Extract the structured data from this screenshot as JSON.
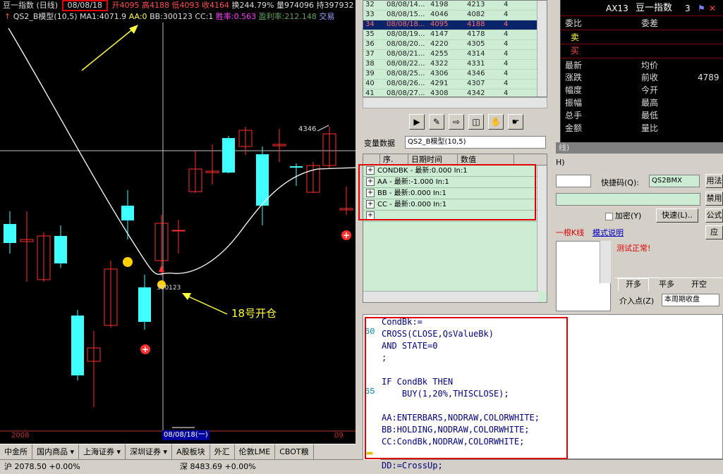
{
  "chart": {
    "header_title": "豆一指数 (日线)",
    "header_date": "08/08/18",
    "header_open": "开4095",
    "header_high": "高4188",
    "header_low": "低4093",
    "header_close": "收4164",
    "header_change": "换244.79%",
    "header_vol": "量974096",
    "header_hold": "持397932",
    "indicator_line": "QS2_B模型(10,5) MA1:4071.9",
    "ind_aa": "AA:0",
    "ind_bb": "BB:300123",
    "ind_cc": "CC:1",
    "ind_winrate": "胜率:0.563",
    "ind_profit": "盈利率:212.148",
    "ind_trade": "交易",
    "price_label_top": "4346",
    "price_label_bottom": "300123",
    "annotation": "18号开仓",
    "axis_year_left": "2008",
    "axis_date": "08/08/18(一)",
    "axis_right": "09",
    "colors": {
      "up": "#ff3030",
      "down": "#40ffff",
      "ma": "#ffffff",
      "annot": "#ffff40"
    }
  },
  "tabs": [
    "中金所",
    "国内商品 ▾",
    "上海证券 ▾",
    "深圳证券 ▾",
    "A股板块",
    "外汇",
    "伦敦LME",
    "CBOT粮"
  ],
  "status": {
    "sh": "沪 2078.50 +0.00%",
    "sz": "深 8483.69 +0.00%"
  },
  "table_rows": [
    [
      "32",
      "08/08/14...",
      "4198",
      "4213",
      "4"
    ],
    [
      "33",
      "08/08/15...",
      "4046",
      "4082",
      "4"
    ],
    [
      "34",
      "08/08/18...",
      "4095",
      "4188",
      "4"
    ],
    [
      "35",
      "08/08/19...",
      "4147",
      "4178",
      "4"
    ],
    [
      "36",
      "08/08/20...",
      "4220",
      "4305",
      "4"
    ],
    [
      "37",
      "08/08/21...",
      "4255",
      "4314",
      "4"
    ],
    [
      "38",
      "08/08/22...",
      "4322",
      "4331",
      "4"
    ],
    [
      "39",
      "08/08/25...",
      "4306",
      "4346",
      "4"
    ],
    [
      "40",
      "08/08/26...",
      "4291",
      "4307",
      "4"
    ],
    [
      "41",
      "08/08/27...",
      "4308",
      "4342",
      "4"
    ]
  ],
  "var": {
    "label": "变量数据",
    "field": "QS2_B模型(10,5)",
    "cols": [
      "序.",
      "日期时间",
      "数值"
    ],
    "rows": [
      "CONDBK  -  最新:0.000  In:1",
      "AA  -  最新:-1.000  In:1",
      "BB  -  最新:0.000  In:1",
      "CC  -  最新:0.000  In:1"
    ]
  },
  "code": [
    "CondBk:=",
    "CROSS(CLOSE,QsValueBk)",
    "AND STATE=0",
    ";",
    "",
    "IF CondBk THEN",
    "    BUY(1,20%,THISCLOSE);",
    "",
    "AA:ENTERBARS,NODRAW,COLORWHITE;",
    "BB:HOLDING,NODRAW,COLORWHITE;",
    "CC:CondBk,NODRAW,COLORWHITE;",
    "",
    "DD:=CrossUp;"
  ],
  "line_numbers": [
    "60",
    "65"
  ],
  "quote": {
    "symbol": "AX13",
    "name": "豆一指数",
    "num": "3",
    "weibi": "委比",
    "weicha": "委差",
    "sell": "卖",
    "buy": "买",
    "latest": "最新",
    "avg": "均价",
    "change": "涨跌",
    "prevclose": "前收",
    "prevclose_val": "4789",
    "amp": "幅度",
    "open": "今开",
    "swing": "振幅",
    "high": "最高",
    "total": "总手",
    "low": "最低",
    "amount": "金额",
    "volratio": "量比"
  },
  "dialog": {
    "title": "线)",
    "h": "H)",
    "shortcut_label": "快捷码(Q):",
    "shortcut": "QS2BMX",
    "use": "用法",
    "forbid": "禁用",
    "encrypt": "加密(Y)",
    "fast": "快速(L)..",
    "public": "公式",
    "apply": "应",
    "one_bar": "一根K线",
    "model_desc": "模式说明",
    "test_ok": "测试正常!",
    "tab1": "开多",
    "tab2": "平多",
    "tab3": "开空",
    "entry_label": "介入点(Z)",
    "entry_value": "本周期收盘"
  }
}
